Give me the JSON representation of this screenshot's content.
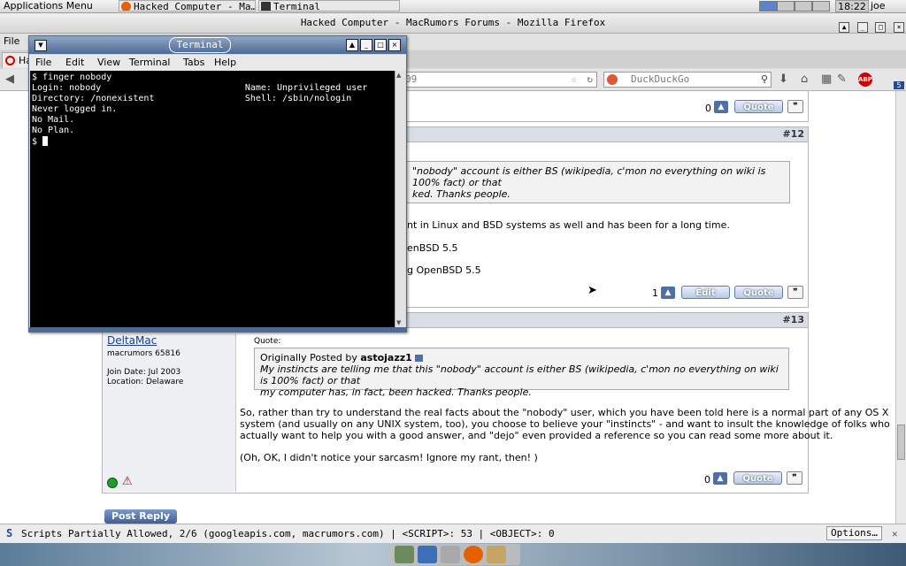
{
  "panel": {
    "apps_menu": "Applications Menu",
    "tasks": [
      "Hacked Computer - Ma…",
      "Terminal"
    ],
    "clock": "18:22",
    "user": "joe"
  },
  "firefox": {
    "title": "Hacked Computer - MacRumors Forums - Mozilla Firefox",
    "menu_file": "File",
    "tab_label": "Ha",
    "url_fragment": "09",
    "search_placeholder": "DuckDuckGo",
    "abp_label": "ABP",
    "badge_count": "5"
  },
  "forum": {
    "post11": {
      "votes": "0",
      "quote": "Quote"
    },
    "post12": {
      "number": "#12",
      "quote_line1": "\"nobody\" account is either BS (wikipedia, c'mon no everything on wiki is 100% fact) or that",
      "quote_line2": "ked. Thanks people.",
      "body_line1": "nt in Linux and BSD systems as well and has been for a long time.",
      "body_line2": "enBSD 5.5",
      "body_line3": "g OpenBSD 5.5",
      "votes": "1",
      "edit": "Edit",
      "quote": "Quote"
    },
    "post13": {
      "number": "#13",
      "username": "DeltaMac",
      "rank": "macrumors 65816",
      "join_date": "Join Date:  Jul 2003",
      "location": "Location: Delaware",
      "quote_label": "Quote:",
      "originally_posted": "Originally Posted by",
      "quote_author": "astojazz1",
      "quote_line1": "My instincts are telling me that this \"nobody\" account is either BS (wikipedia, c'mon no everything on wiki is 100% fact) or that",
      "quote_line2": "my computer has, in fact, been hacked. Thanks people.",
      "body_line1": "So, rather than try to understand the real facts about the \"nobody\" user, which you have been told here is a normal part of any OS X",
      "body_line2": "system (and usually on any UNIX system, too), you choose to believe your \"instincts\" - and want to insult the knowledge of folks who",
      "body_line3": "actually want to help you with a good answer, and \"dejo\" even provided a reference so you can read some more about it.",
      "body_line4": "(Oh, OK, I didn't notice your sarcasm! Ignore my rant, then! )",
      "votes": "0",
      "quote": "Quote"
    },
    "post_reply": "Post Reply"
  },
  "statusbar": {
    "text": "Scripts Partially Allowed, 2/6 (googleapis.com, macrumors.com) | <SCRIPT>: 53 | <OBJECT>: 0",
    "options": "Options…",
    "close": "✕"
  },
  "terminal": {
    "title": "Terminal",
    "menus": [
      "File",
      "Edit",
      "View",
      "Terminal",
      "Tabs",
      "Help"
    ],
    "lines": [
      "$ finger nobody",
      "Login: nobody                           Name: Unprivileged user",
      "Directory: /nonexistent                 Shell: /sbin/nologin",
      "Never logged in.",
      "No Mail.",
      "No Plan.",
      "$ "
    ]
  },
  "colors": {
    "terminal_bg": "#000000",
    "titlebar_blue": "#4d6a95",
    "link_blue": "#1a3e91"
  }
}
